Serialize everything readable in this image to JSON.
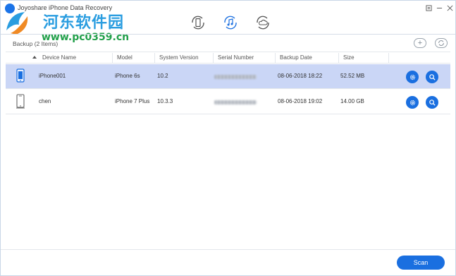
{
  "window": {
    "title": "Joyoshare iPhone Data Recovery",
    "controls": [
      "menu-icon",
      "minimize-icon",
      "close-icon"
    ]
  },
  "watermark": {
    "line1": "河东软件园",
    "line2": "www.pc0359.cn"
  },
  "modes": [
    {
      "name": "recover-from-ios-device",
      "icon": "phone-refresh-icon",
      "active": false
    },
    {
      "name": "recover-from-itunes",
      "icon": "music-note-refresh-icon",
      "active": true
    },
    {
      "name": "recover-from-icloud",
      "icon": "cloud-refresh-icon",
      "active": false
    }
  ],
  "section": {
    "title": "Backup (2 Items)",
    "actions": [
      "add-icon",
      "refresh-icon"
    ]
  },
  "table": {
    "columns": [
      "Device Name",
      "Model",
      "System Version",
      "Serial Number",
      "Backup Date",
      "Size"
    ],
    "rows": [
      {
        "device": "iPhone001",
        "model": "iPhone 6s",
        "version": "10.2",
        "serial": "",
        "date": "08-06-2018 18:22",
        "size": "52.52 MB",
        "selected": true
      },
      {
        "device": "chen",
        "model": "iPhone 7 Plus",
        "version": "10.3.3",
        "serial": "",
        "date": "08-06-2018 19:02",
        "size": "14.00 GB",
        "selected": false
      }
    ]
  },
  "footer": {
    "scan_label": "Scan"
  },
  "colors": {
    "accent": "#1a6fe0",
    "selected_row": "#cad6f6"
  }
}
